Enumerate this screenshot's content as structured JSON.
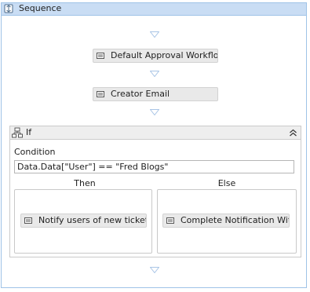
{
  "sequence": {
    "title": "Sequence"
  },
  "activities": {
    "default_approval": "Default Approval Workflow",
    "creator_email": "Creator Email"
  },
  "if_block": {
    "title": "If",
    "condition_label": "Condition",
    "condition_value": "Data.Data[\"User\"] == \"Fred Blogs\"",
    "then_label": "Then",
    "else_label": "Else",
    "then_activity": "Notify users of new ticket",
    "else_activity": "Complete Notification Witl"
  },
  "icons": {
    "sequence": "sequence-icon",
    "activity": "activity-icon",
    "if": "if-icon",
    "collapse": "double-chevron-up-icon",
    "drop": "drop-arrow-icon"
  },
  "colors": {
    "sequence_header": "#c9ddf4",
    "sequence_border": "#9fc3e7",
    "activity_fill": "#e9e9e9",
    "arrow": "#a9c5e6"
  }
}
